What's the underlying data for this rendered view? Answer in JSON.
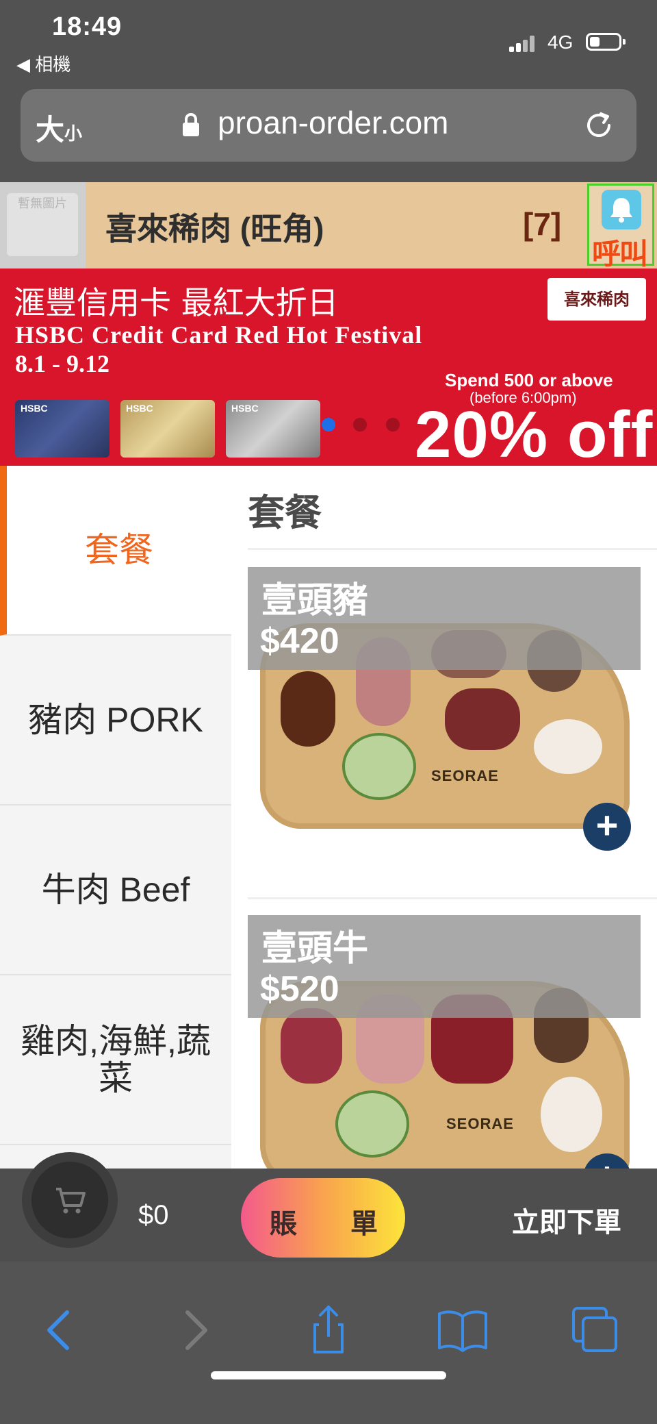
{
  "status_bar": {
    "time": "18:49",
    "back_app": "◀ 相機",
    "network": "4G"
  },
  "address_bar": {
    "text_size_label": "大",
    "text_size_small": "小",
    "url": "proan-order.com"
  },
  "shop": {
    "logo_placeholder": "暫無圖片",
    "name": "喜來稀肉 (旺角)",
    "table": "[7]",
    "call_label": "呼叫"
  },
  "banner": {
    "title_zh": "滙豐信用卡 最紅大折日",
    "title_en": "HSBC Credit Card Red Hot Festival",
    "dates": "8.1 - 9.12",
    "logo_text": "喜來稀肉",
    "spend": "Spend 500 or above",
    "before": "(before 6:00pm)",
    "discount": "20% off",
    "card_brand": "HSBC",
    "slides": 3,
    "active_slide": 1
  },
  "sidebar": {
    "items": [
      {
        "label": "套餐",
        "active": true
      },
      {
        "label": "豬肉 PORK",
        "active": false
      },
      {
        "label": "牛肉 Beef",
        "active": false
      },
      {
        "label": "雞肉,海鮮,蔬菜",
        "active": false
      }
    ]
  },
  "menu": {
    "section_title": "套餐",
    "items": [
      {
        "name": "壹頭豬",
        "price": "$420",
        "board_text": "SEORAE"
      },
      {
        "name": "壹頭牛",
        "price": "$520",
        "board_text": "SEORAE"
      }
    ]
  },
  "bottom_bar": {
    "cart_total": "$0",
    "bill_left": "賬",
    "bill_right": "單",
    "order_now": "立即下單"
  },
  "browser_toolbar": {
    "icons": [
      "back-icon",
      "forward-icon",
      "share-icon",
      "bookmarks-icon",
      "tabs-icon"
    ]
  },
  "colors": {
    "accent_orange": "#f06a14",
    "banner_red": "#d8152a",
    "header_tan": "#e7c69a",
    "add_button": "#1a3e66",
    "link_blue": "#3b8de8"
  }
}
